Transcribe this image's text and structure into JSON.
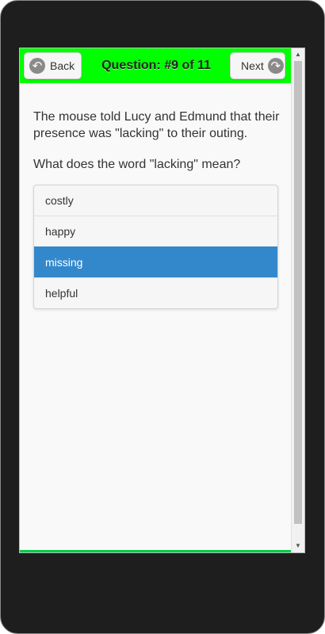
{
  "header": {
    "back_label": "Back",
    "next_label": "Next",
    "title": "Question: #9 of 11",
    "accent_color": "#00ff00"
  },
  "question": {
    "passage": "The mouse told Lucy and Edmund that their presence was \"lacking\" to their outing.",
    "prompt": "What does the word \"lacking\" mean?"
  },
  "options": [
    {
      "label": "costly",
      "selected": false
    },
    {
      "label": "happy",
      "selected": false
    },
    {
      "label": "missing",
      "selected": true
    },
    {
      "label": "helpful",
      "selected": false
    }
  ],
  "selected_color": "#3388cc"
}
